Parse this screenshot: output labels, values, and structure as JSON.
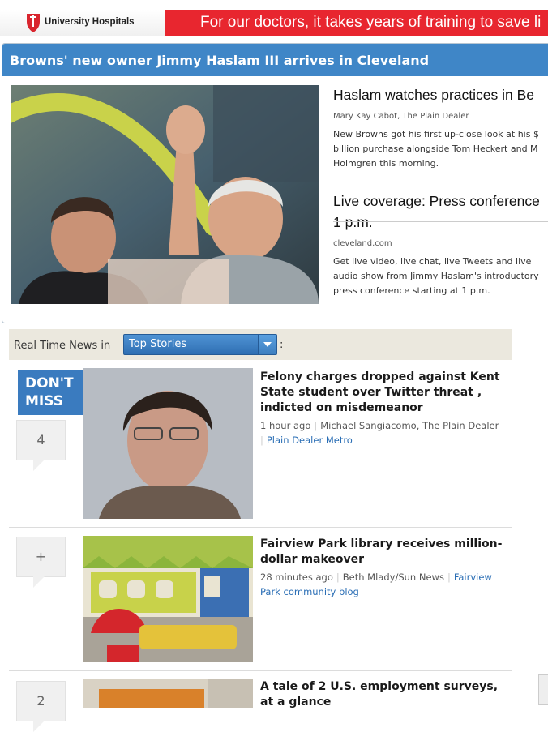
{
  "ad": {
    "brand": "University Hospitals",
    "tagline": "For our doctors, it takes years of training to save li"
  },
  "feature": {
    "title": "Browns' new owner Jimmy Haslam III arrives in Cleveland",
    "stories": [
      {
        "headline": "Haslam watches practices in Be",
        "byline": "Mary Kay Cabot, The Plain Dealer",
        "blurb": [
          "New Browns got his first up-close look at his $",
          "billion purchase alongside Tom Heckert and M",
          "Holmgren this morning."
        ]
      },
      {
        "headline_lines": [
          "Live coverage: Press conference",
          "1 p.m."
        ],
        "byline": "cleveland.com",
        "blurb": [
          "Get live video, live chat, live Tweets and live",
          "audio show from Jimmy Haslam's introductory",
          "press conference starting at 1 p.m."
        ]
      }
    ]
  },
  "realtime": {
    "label": "Real Time News in",
    "selected": "Top Stories",
    "colon": ":"
  },
  "badge": {
    "line1": "DON'T",
    "line2": "MISS"
  },
  "items": [
    {
      "count": "4",
      "headline": "Felony charges dropped against Kent State student over Twitter threat , indicted on misdemeanor",
      "time": "1 hour ago",
      "author": "Michael Sangiacomo, The Plain Dealer",
      "section": "Plain Dealer Metro"
    },
    {
      "count": "+",
      "headline": "Fairview Park library receives million-dollar makeover",
      "time": "28 minutes ago",
      "author": "Beth Mlady/Sun News",
      "section": "Fairview Park community blog"
    },
    {
      "count": "2",
      "headline": "A tale of 2 U.S. employment surveys, at a glance"
    }
  ],
  "colors": {
    "accent": "#3f86c7",
    "ad_red": "#e8262f",
    "link": "#2a6eb5"
  }
}
